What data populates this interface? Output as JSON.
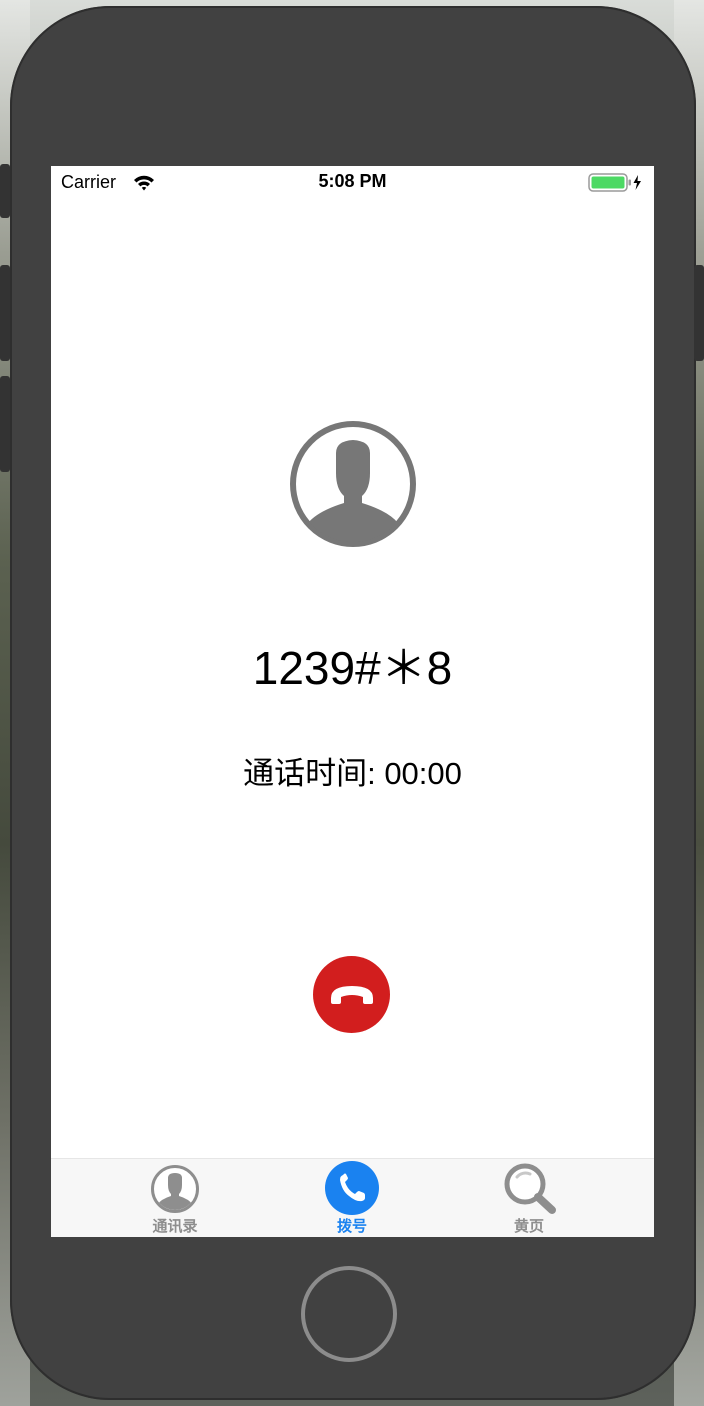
{
  "status_bar": {
    "carrier": "Carrier",
    "time": "5:08 PM",
    "battery_color": "#4cd964"
  },
  "call": {
    "number": "1239#＊8",
    "duration": "通话时间: 00:00",
    "hangup_color": "#d21e1e",
    "avatar_color": "#777777"
  },
  "tabbar": {
    "items": [
      {
        "label": "通讯录",
        "icon": "person-circle-icon",
        "color": "#8e8e8e",
        "selected": false
      },
      {
        "label": "拨号",
        "icon": "phone-icon",
        "color": "#1a82f0",
        "selected": true
      },
      {
        "label": "黄页",
        "icon": "magnifier-icon",
        "color": "#8e8e8e",
        "selected": false
      }
    ]
  }
}
